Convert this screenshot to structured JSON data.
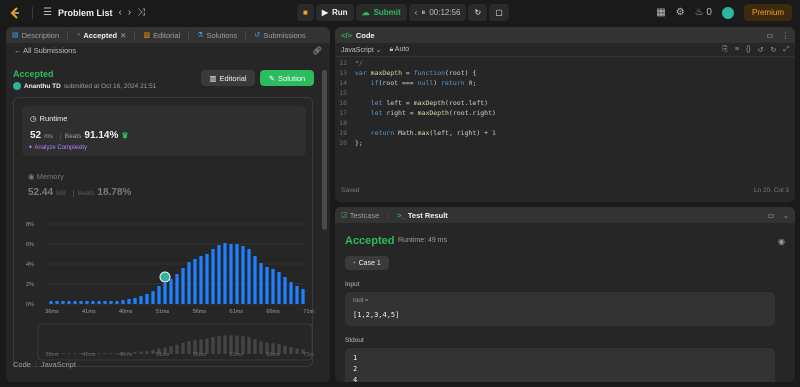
{
  "topbar": {
    "title": "Problem List",
    "run": "Run",
    "submit": "Submit",
    "timer": "00:12:56",
    "streak": "0",
    "premium": "Premium"
  },
  "left": {
    "tabs": [
      "Description",
      "Accepted",
      "Editorial",
      "Solutions",
      "Submissions"
    ],
    "back": "All Submissions",
    "status": "Accepted",
    "user": "Ananthu TD",
    "submitted": "submitted at Oct 16, 2024 21:51",
    "editorial_btn": "Editorial",
    "solution_btn": "Solution",
    "runtime_label": "Runtime",
    "runtime_value": "52",
    "runtime_unit": "ms",
    "beats": "Beats",
    "runtime_pct": "91.14%",
    "analyze": "Analyze Complexity",
    "memory_label": "Memory",
    "memory_value": "52.44",
    "memory_unit": "MB",
    "memory_pct": "18.78%",
    "code_label": "Code",
    "lang": "JavaScript"
  },
  "chart_data": {
    "type": "bar",
    "y_ticks": [
      "8%",
      "6%",
      "4%",
      "2%",
      "0%"
    ],
    "x_ticks": [
      "36ms",
      "41ms",
      "46ms",
      "51ms",
      "56ms",
      "61ms",
      "66ms",
      "71ms"
    ],
    "ylim": [
      0,
      8
    ],
    "values": [
      0.3,
      0.3,
      0.3,
      0.3,
      0.3,
      0.3,
      0.3,
      0.3,
      0.3,
      0.3,
      0.3,
      0.3,
      0.4,
      0.5,
      0.6,
      0.8,
      1.0,
      1.3,
      1.8,
      2.1,
      2.5,
      3.0,
      3.6,
      4.2,
      4.5,
      4.8,
      5.0,
      5.5,
      5.9,
      6.1,
      6.0,
      6.0,
      5.8,
      5.5,
      4.8,
      4.1,
      3.7,
      3.5,
      3.2,
      2.7,
      2.2,
      1.8,
      1.5
    ],
    "highlight_index": 19,
    "color": "#1e7fff"
  },
  "code": {
    "title": "Code",
    "lang": "JavaScript",
    "auto": "Auto",
    "lines": [
      {
        "n": "12",
        "t": "*/"
      },
      {
        "n": "13",
        "t": "var maxDepth = function(root) {"
      },
      {
        "n": "14",
        "t": "    if(root === null) return 0;"
      },
      {
        "n": "15",
        "t": ""
      },
      {
        "n": "16",
        "t": "    let left = maxDepth(root.left)"
      },
      {
        "n": "17",
        "t": "    let right = maxDepth(root.right)"
      },
      {
        "n": "18",
        "t": ""
      },
      {
        "n": "19",
        "t": "    return Math.max(left, right) + 1"
      },
      {
        "n": "20",
        "t": "};"
      }
    ],
    "saved": "Saved",
    "position": "Ln 20, Col 3"
  },
  "result": {
    "tab1": "Testcase",
    "tab2": "Test Result",
    "status": "Accepted",
    "runtime": "Runtime: 49 ms",
    "case": "Case 1",
    "input_label": "Input",
    "input_var": "root =",
    "input_val": "[1,2,3,4,5]",
    "stdout_label": "Stdout",
    "stdout_lines": [
      "1",
      "2",
      "4"
    ]
  }
}
